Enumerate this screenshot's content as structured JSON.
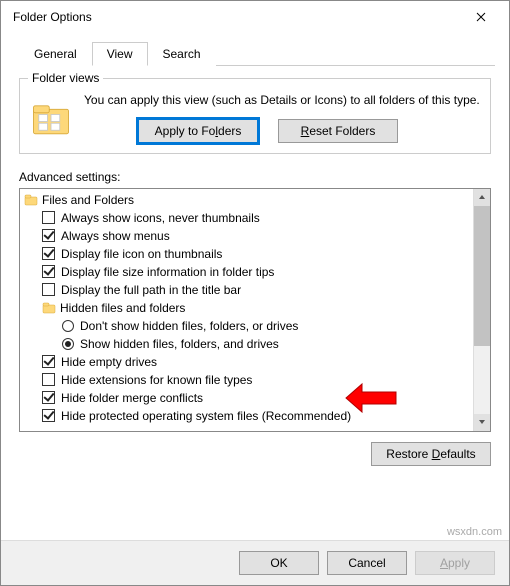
{
  "title": "Folder Options",
  "tabs": {
    "general": "General",
    "view": "View",
    "search": "Search",
    "active": "view"
  },
  "folderViews": {
    "groupLabel": "Folder views",
    "text": "You can apply this view (such as Details or Icons) to all folders of this type.",
    "applyBtn": "Apply to Folders",
    "applyBtn_u": "l",
    "resetBtn": "Reset Folders",
    "resetBtn_u": "R"
  },
  "advancedLabel": "Advanced settings:",
  "tree": [
    {
      "type": "folder",
      "level": 0,
      "label": "Files and Folders"
    },
    {
      "type": "checkbox",
      "level": 1,
      "checked": false,
      "label": "Always show icons, never thumbnails"
    },
    {
      "type": "checkbox",
      "level": 1,
      "checked": true,
      "label": "Always show menus"
    },
    {
      "type": "checkbox",
      "level": 1,
      "checked": true,
      "label": "Display file icon on thumbnails"
    },
    {
      "type": "checkbox",
      "level": 1,
      "checked": true,
      "label": "Display file size information in folder tips"
    },
    {
      "type": "checkbox",
      "level": 1,
      "checked": false,
      "label": "Display the full path in the title bar"
    },
    {
      "type": "folder",
      "level": 1,
      "label": "Hidden files and folders"
    },
    {
      "type": "radio",
      "level": 2,
      "selected": false,
      "label": "Don't show hidden files, folders, or drives"
    },
    {
      "type": "radio",
      "level": 2,
      "selected": true,
      "label": "Show hidden files, folders, and drives"
    },
    {
      "type": "checkbox",
      "level": 1,
      "checked": true,
      "label": "Hide empty drives"
    },
    {
      "type": "checkbox",
      "level": 1,
      "checked": false,
      "label": "Hide extensions for known file types"
    },
    {
      "type": "checkbox",
      "level": 1,
      "checked": true,
      "label": "Hide folder merge conflicts"
    },
    {
      "type": "checkbox",
      "level": 1,
      "checked": true,
      "label": "Hide protected operating system files (Recommended)"
    }
  ],
  "restoreDefaults": "Restore Defaults",
  "restoreDefaults_u": "D",
  "footer": {
    "ok": "OK",
    "cancel": "Cancel",
    "apply": "Apply",
    "apply_u": "A"
  },
  "watermark": "wsxdn.com"
}
